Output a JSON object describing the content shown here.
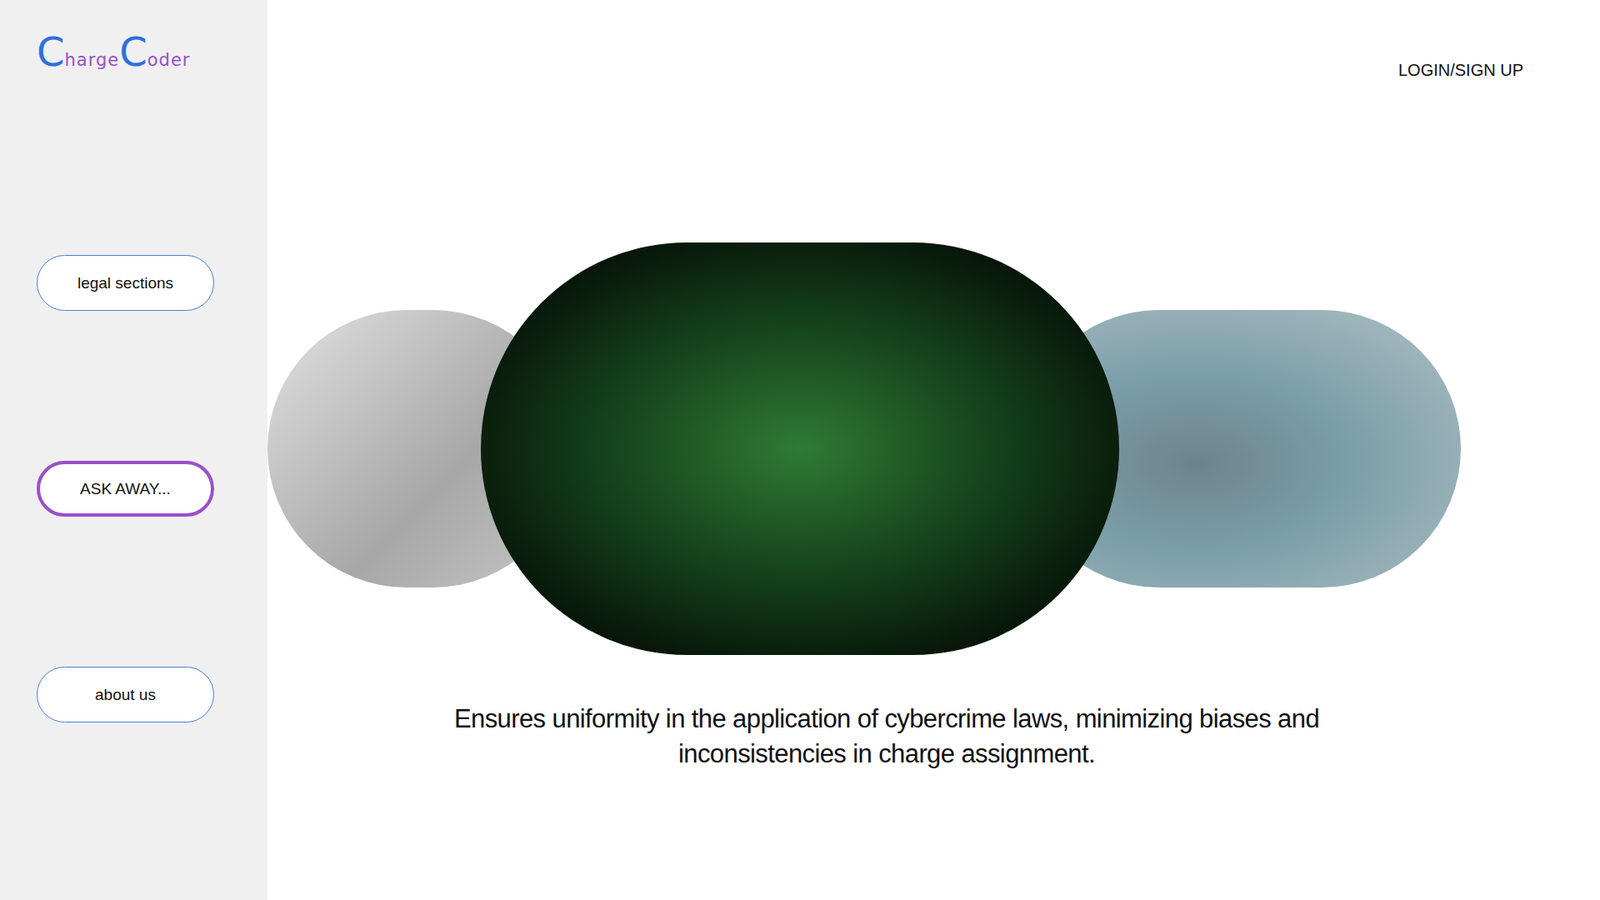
{
  "logo": [
    {
      "text": "C",
      "kind": "initial"
    },
    {
      "text": "harge",
      "kind": "rest"
    },
    {
      "text": "C",
      "kind": "initial"
    },
    {
      "text": "oder",
      "kind": "rest"
    }
  ],
  "header": {
    "login": "LOGIN/SIGN UP"
  },
  "sidebar": {
    "items": [
      {
        "label": "legal sections",
        "selected": false
      },
      {
        "label": "ASK AWAY...",
        "selected": true
      },
      {
        "label": "about us",
        "selected": false
      }
    ]
  },
  "carousel": {
    "slides": [
      {
        "selected": false
      },
      {
        "selected": true
      },
      {
        "selected": false
      }
    ]
  },
  "caption": "Ensures uniformity in the application of cybercrime laws, minimizing biases and inconsistencies in charge assignment."
}
